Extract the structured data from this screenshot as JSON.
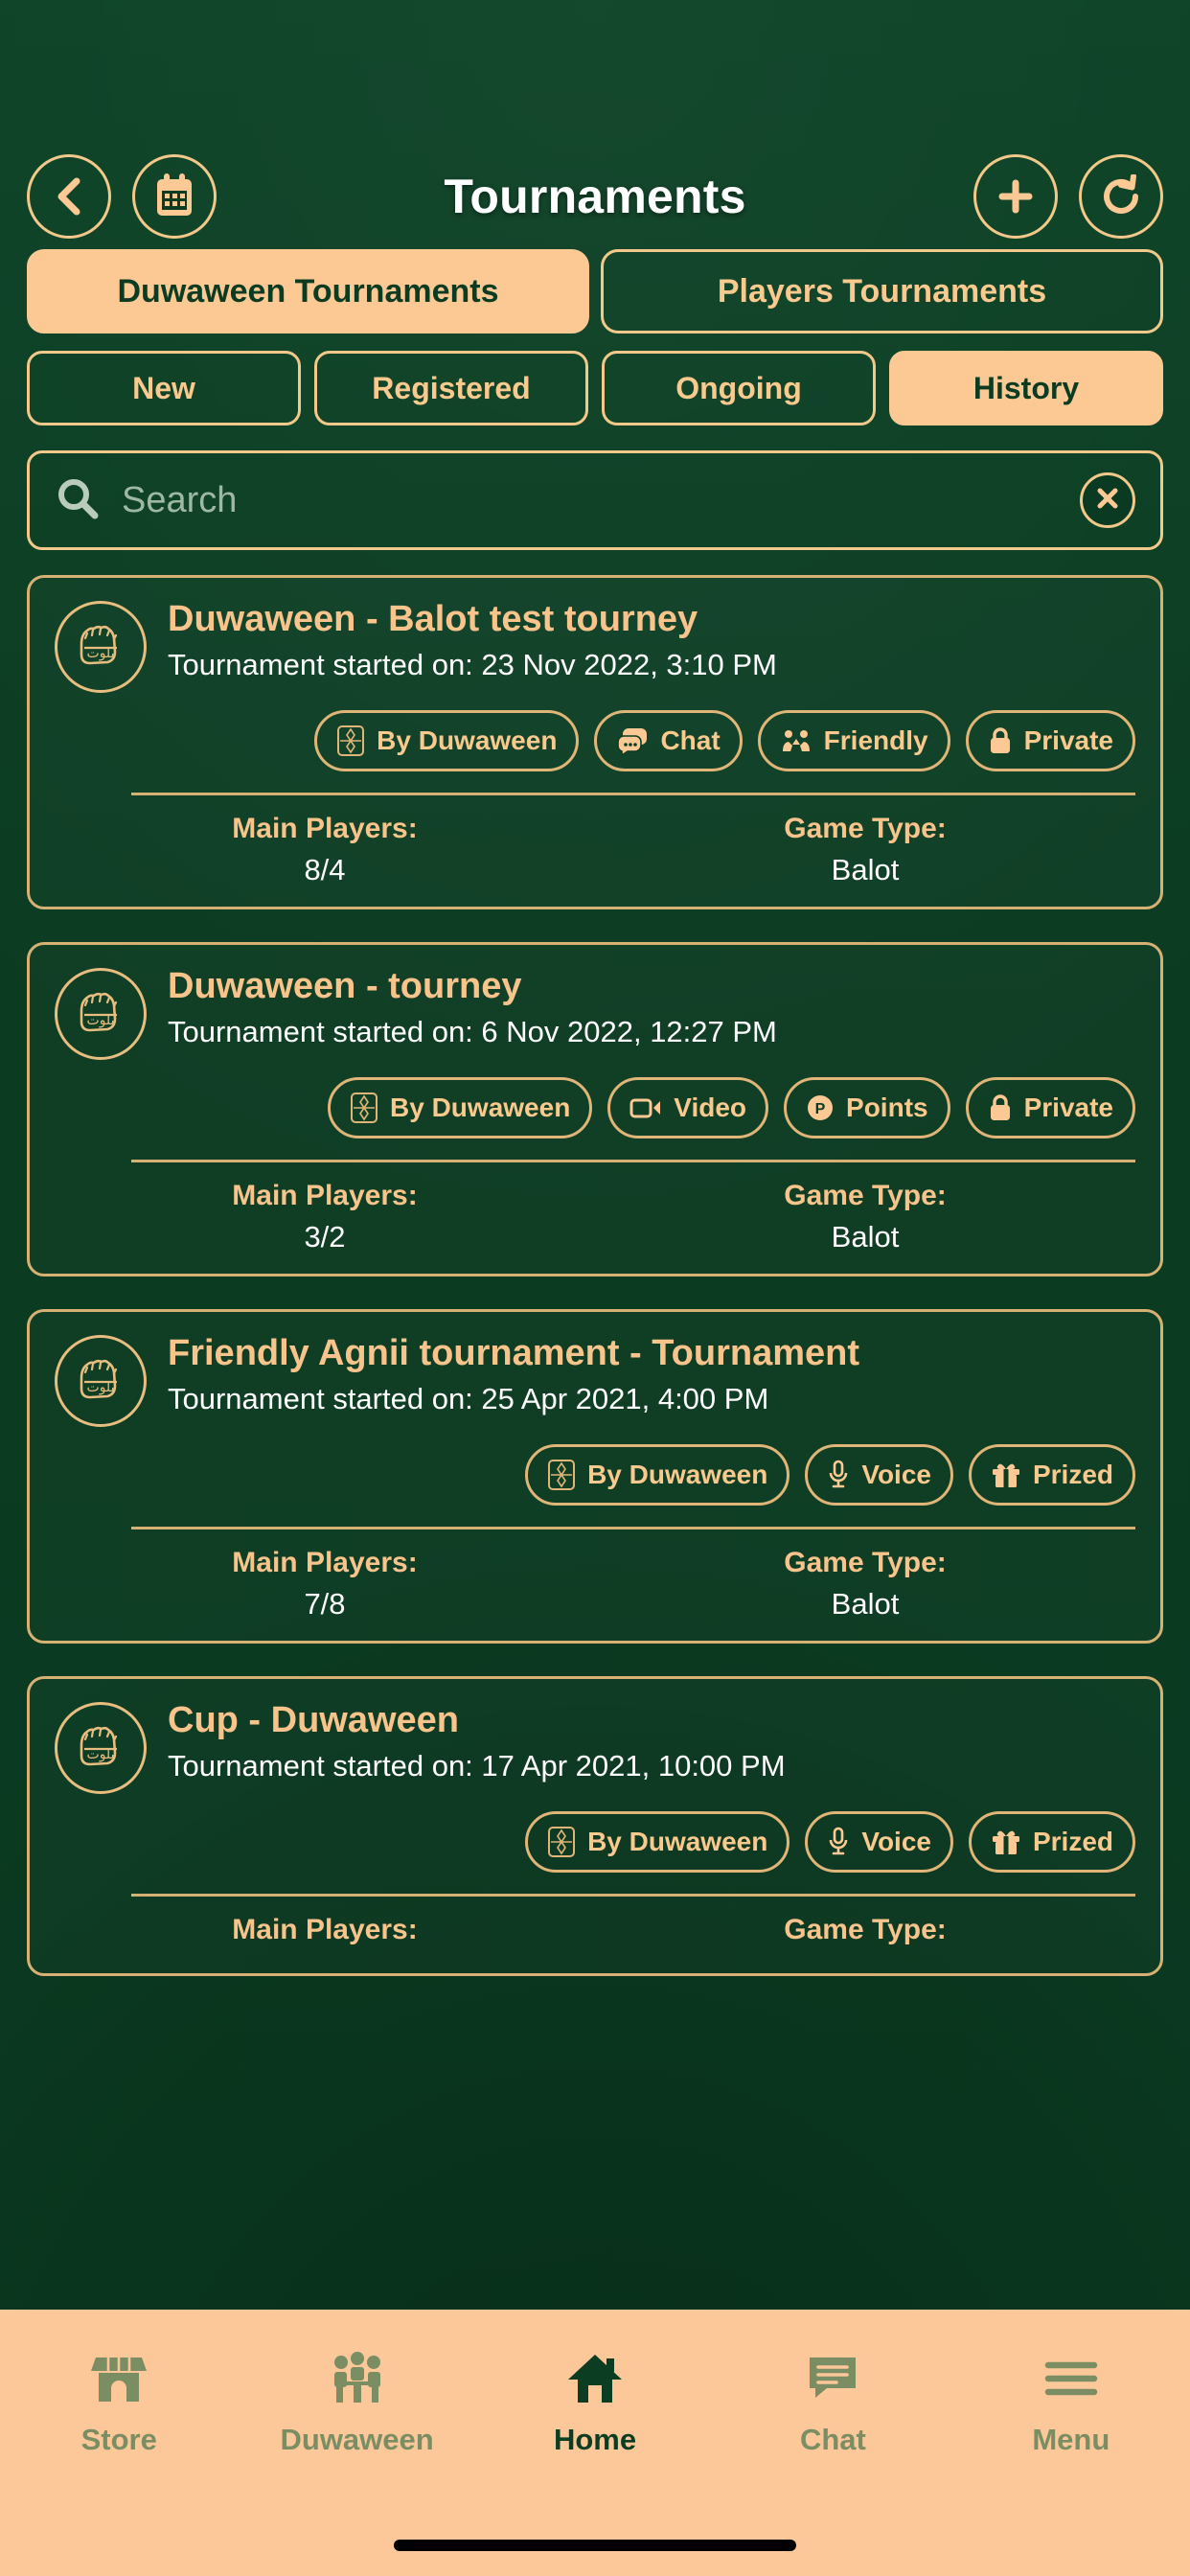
{
  "header": {
    "title": "Tournaments",
    "back_icon": "chevron-left-icon",
    "calendar_icon": "calendar-icon",
    "add_icon": "plus-icon",
    "refresh_icon": "refresh-icon"
  },
  "main_tabs": [
    {
      "label": "Duwaween Tournaments",
      "active": true
    },
    {
      "label": "Players Tournaments",
      "active": false
    }
  ],
  "sub_tabs": [
    {
      "label": "New",
      "active": false
    },
    {
      "label": "Registered",
      "active": false
    },
    {
      "label": "Ongoing",
      "active": false
    },
    {
      "label": "History",
      "active": true
    }
  ],
  "search": {
    "placeholder": "Search",
    "value": "",
    "search_icon": "search-icon",
    "clear_icon": "close-icon"
  },
  "stat_labels": {
    "main_players": "Main Players:",
    "game_type": "Game Type:"
  },
  "tournaments": [
    {
      "title": "Duwaween - Balot test tourney",
      "subtitle": "Tournament started on: 23 Nov 2022, 3:10 PM",
      "avatar_icon": "balot-emblem-icon",
      "badges": [
        {
          "label": "By Duwaween",
          "icon": "duwaween-emblem-icon"
        },
        {
          "label": "Chat",
          "icon": "chat-bubbles-icon"
        },
        {
          "label": "Friendly",
          "icon": "friendly-handshake-icon"
        },
        {
          "label": "Private",
          "icon": "lock-icon"
        }
      ],
      "main_players": "8/4",
      "game_type": "Balot"
    },
    {
      "title": "Duwaween - tourney",
      "subtitle": "Tournament started on: 6 Nov 2022, 12:27 PM",
      "avatar_icon": "balot-emblem-icon",
      "badges": [
        {
          "label": "By Duwaween",
          "icon": "duwaween-emblem-icon"
        },
        {
          "label": "Video",
          "icon": "video-camera-icon"
        },
        {
          "label": "Points",
          "icon": "points-circle-icon"
        },
        {
          "label": "Private",
          "icon": "lock-icon"
        }
      ],
      "main_players": "3/2",
      "game_type": "Balot"
    },
    {
      "title": "Friendly Agnii tournament - Tournament",
      "subtitle": "Tournament started on: 25 Apr 2021, 4:00 PM",
      "avatar_icon": "balot-emblem-icon",
      "badges": [
        {
          "label": "By Duwaween",
          "icon": "duwaween-emblem-icon"
        },
        {
          "label": "Voice",
          "icon": "microphone-icon"
        },
        {
          "label": "Prized",
          "icon": "gift-icon"
        }
      ],
      "main_players": "7/8",
      "game_type": "Balot"
    },
    {
      "title": "Cup - Duwaween",
      "subtitle": "Tournament started on: 17 Apr 2021, 10:00 PM",
      "avatar_icon": "balot-emblem-icon",
      "badges": [
        {
          "label": "By Duwaween",
          "icon": "duwaween-emblem-icon"
        },
        {
          "label": "Voice",
          "icon": "microphone-icon"
        },
        {
          "label": "Prized",
          "icon": "gift-icon"
        }
      ],
      "main_players": "",
      "game_type": ""
    }
  ],
  "bottom_nav": [
    {
      "label": "Store",
      "icon": "store-icon",
      "active": false
    },
    {
      "label": "Duwaween",
      "icon": "people-table-icon",
      "active": false
    },
    {
      "label": "Home",
      "icon": "home-icon",
      "active": true
    },
    {
      "label": "Chat",
      "icon": "chat-icon",
      "active": false
    },
    {
      "label": "Menu",
      "icon": "hamburger-menu-icon",
      "active": false
    }
  ],
  "colors": {
    "background": "#0b3b21",
    "accent": "#fcc995",
    "gold_border": "#f2c98a",
    "title_text": "#f8c48b",
    "white_text": "#ffffff",
    "nav_inactive": "#7a8d63",
    "nav_active": "#0b3d22"
  }
}
